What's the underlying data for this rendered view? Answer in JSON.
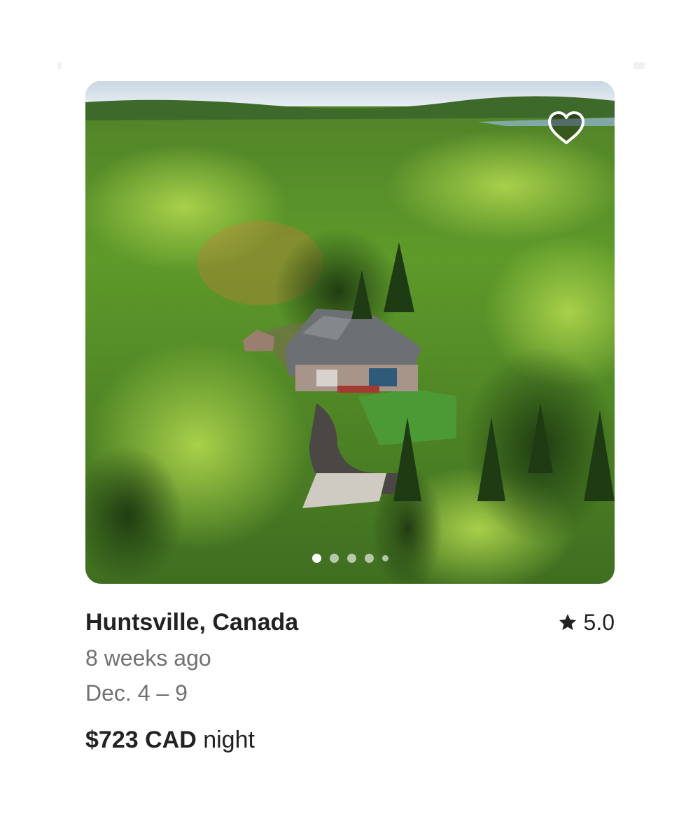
{
  "listing": {
    "location": "Huntsville, Canada",
    "rating": "5.0",
    "posted": "8 weeks ago",
    "dates": "Dec. 4 – 9",
    "price": "$723 CAD",
    "price_unit": "night"
  },
  "photo": {
    "current_index": 1,
    "visible_dots": 5,
    "description_icon": "wishlist-heart-icon"
  },
  "colors": {
    "title": "#222222",
    "secondary": "#717171"
  }
}
